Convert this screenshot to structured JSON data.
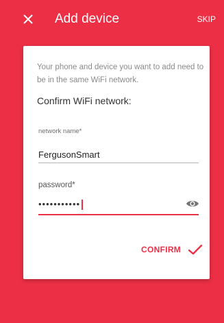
{
  "appbar": {
    "title": "Add device",
    "skip_label": "SKIP"
  },
  "card": {
    "info_text": "Your phone and device you want to add need to be in the same WiFi network.",
    "heading": "Confirm WiFi network:",
    "network_field": {
      "label": "network name*",
      "value": "FergusonSmart"
    },
    "password_field": {
      "label": "password*",
      "masked_value": "•••••••••••"
    },
    "confirm_label": "CONFIRM"
  },
  "colors": {
    "accent": "#ec2f45",
    "card": "#ffffff"
  }
}
